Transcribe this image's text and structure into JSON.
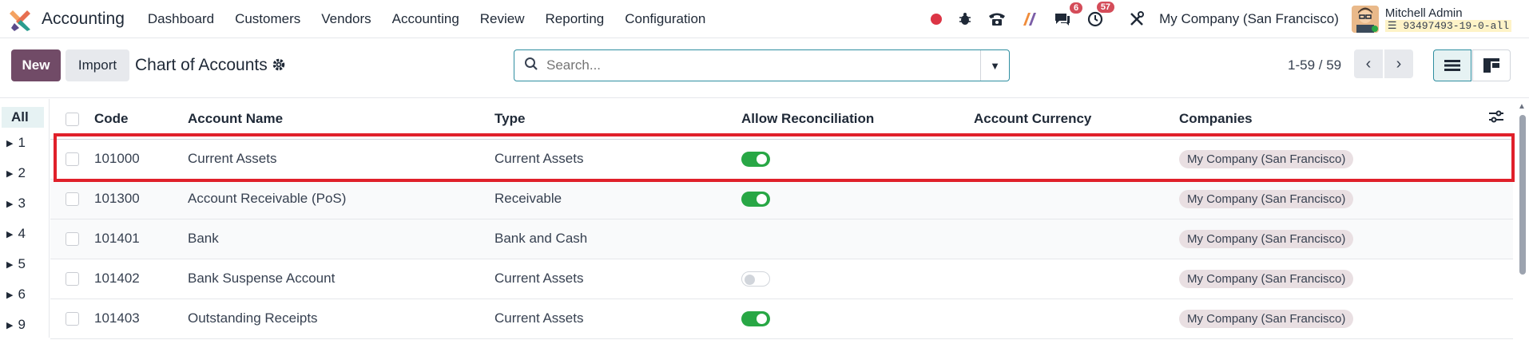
{
  "app": {
    "name": "Accounting"
  },
  "menu": [
    "Dashboard",
    "Customers",
    "Vendors",
    "Accounting",
    "Review",
    "Reporting",
    "Configuration"
  ],
  "systray": {
    "messages_badge": "6",
    "activities_badge": "57",
    "company": "My Company (San Francisco)",
    "user_name": "Mitchell Admin",
    "database": "93497493-19-0-all"
  },
  "control": {
    "new_label": "New",
    "import_label": "Import",
    "title": "Chart of Accounts",
    "search_placeholder": "Search...",
    "pager": "1-59 / 59"
  },
  "sidebar": {
    "items": [
      {
        "label": "All"
      },
      {
        "label": "1"
      },
      {
        "label": "2"
      },
      {
        "label": "3"
      },
      {
        "label": "4"
      },
      {
        "label": "5"
      },
      {
        "label": "6"
      },
      {
        "label": "9"
      }
    ]
  },
  "table": {
    "headers": {
      "code": "Code",
      "name": "Account Name",
      "type": "Type",
      "reconcile": "Allow Reconciliation",
      "currency": "Account Currency",
      "companies": "Companies"
    },
    "rows": [
      {
        "code": "101000",
        "name": "Current Assets",
        "type": "Current Assets",
        "reconcile": true,
        "currency": "",
        "company": "My Company (San Francisco)"
      },
      {
        "code": "101300",
        "name": "Account Receivable (PoS)",
        "type": "Receivable",
        "reconcile": true,
        "currency": "",
        "company": "My Company (San Francisco)"
      },
      {
        "code": "101401",
        "name": "Bank",
        "type": "Bank and Cash",
        "reconcile": null,
        "currency": "",
        "company": "My Company (San Francisco)"
      },
      {
        "code": "101402",
        "name": "Bank Suspense Account",
        "type": "Current Assets",
        "reconcile": false,
        "currency": "",
        "company": "My Company (San Francisco)"
      },
      {
        "code": "101403",
        "name": "Outstanding Receipts",
        "type": "Current Assets",
        "reconcile": true,
        "currency": "",
        "company": "My Company (San Francisco)"
      }
    ]
  },
  "colors": {
    "brand": "#714b67",
    "accent": "#2f8ea0",
    "toggle_on": "#28a745",
    "highlight": "#e0202a"
  }
}
